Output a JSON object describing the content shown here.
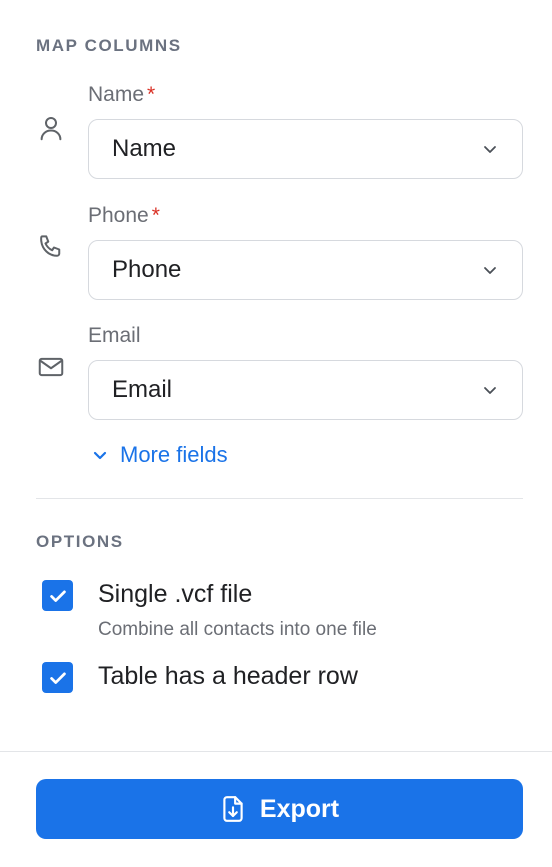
{
  "map_columns": {
    "title": "MAP COLUMNS",
    "fields": [
      {
        "label": "Name",
        "required": true,
        "required_mark": "*",
        "value": "Name",
        "icon": "person-icon"
      },
      {
        "label": "Phone",
        "required": true,
        "required_mark": "*",
        "value": "Phone",
        "icon": "phone-icon"
      },
      {
        "label": "Email",
        "required": false,
        "required_mark": "",
        "value": "Email",
        "icon": "mail-icon"
      }
    ],
    "more_fields_label": "More fields"
  },
  "options": {
    "title": "OPTIONS",
    "single_vcf": {
      "label": "Single .vcf file",
      "description": "Combine all contacts into one file",
      "checked": true
    },
    "header_row": {
      "label": "Table has a header row",
      "checked": true
    }
  },
  "footer": {
    "export_label": "Export"
  },
  "colors": {
    "accent": "#1a73e8",
    "required": "#d93025",
    "muted": "#6b6e75"
  }
}
